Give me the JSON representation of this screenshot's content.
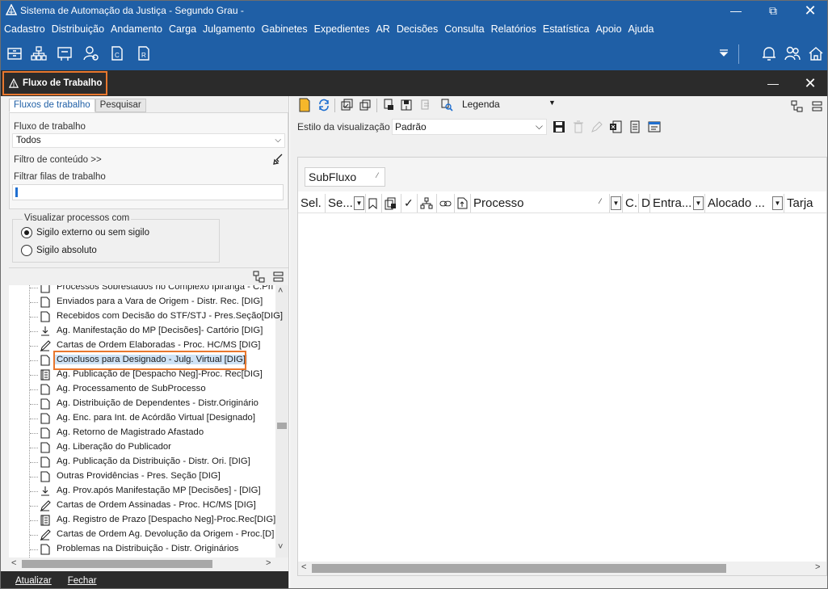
{
  "window": {
    "title": "Sistema de Automação da Justiça - Segundo Grau -",
    "controls": [
      "minimize",
      "restore",
      "close"
    ]
  },
  "menu": [
    "Cadastro",
    "Distribuição",
    "Andamento",
    "Carga",
    "Julgamento",
    "Gabinetes",
    "Expedientes",
    "AR",
    "Decisões",
    "Consulta",
    "Relatórios",
    "Estatística",
    "Apoio",
    "Ajuda"
  ],
  "panel": {
    "title": "Fluxo de Trabalho"
  },
  "left": {
    "tabs": [
      "Fluxos de trabalho",
      "Pesquisar"
    ],
    "fluxo_label": "Fluxo de trabalho",
    "fluxo_value": "Todos",
    "filtro_conteudo": "Filtro de conteúdo >>",
    "filtrar_filas_label": "Filtrar filas de trabalho",
    "filtrar_filas_value": "",
    "visualizar_legend": "Visualizar processos com",
    "radio_externo": "Sigilo externo ou sem sigilo",
    "radio_absoluto": "Sigilo absoluto",
    "tree": [
      {
        "label": "Processos Sobrestados no Complexo Ipiranga - C.Pri",
        "icon": "doc-icon"
      },
      {
        "label": "Enviados para a Vara de Origem - Distr. Rec. [DIG]",
        "icon": "doc-icon"
      },
      {
        "label": "Recebidos com Decisão do STF/STJ - Pres.Seção[DIG]",
        "icon": "doc-icon"
      },
      {
        "label": "Ag. Manifestação do MP [Decisões]- Cartório [DIG]",
        "icon": "download-icon"
      },
      {
        "label": "Cartas de Ordem Elaboradas - Proc. HC/MS [DIG]",
        "icon": "pen-icon"
      },
      {
        "label": "Conclusos para Designado - Julg. Virtual [DIG]",
        "icon": "doc-icon"
      },
      {
        "label": "Ag. Publicação de [Despacho Neg]-Proc. Rec[DIG]",
        "icon": "book-icon"
      },
      {
        "label": "Ag. Processamento de SubProcesso",
        "icon": "doc-icon"
      },
      {
        "label": "Ag. Distribuição de Dependentes - Distr.Originário",
        "icon": "doc-icon"
      },
      {
        "label": "Ag. Enc. para Int. de Acórdão Virtual [Designado]",
        "icon": "doc-icon"
      },
      {
        "label": "Ag. Retorno de Magistrado Afastado",
        "icon": "doc-icon"
      },
      {
        "label": "Ag. Liberação do Publicador",
        "icon": "doc-icon"
      },
      {
        "label": "Ag. Publicação da Distribuição - Distr. Ori. [DIG]",
        "icon": "doc-icon"
      },
      {
        "label": "Outras Providências - Pres. Seção [DIG]",
        "icon": "doc-icon"
      },
      {
        "label": "Ag. Prov.após Manifestação MP [Decisões] - [DIG]",
        "icon": "download-icon"
      },
      {
        "label": "Cartas de Ordem Assinadas - Proc. HC/MS [DIG]",
        "icon": "pen-icon"
      },
      {
        "label": "Ag. Registro de Prazo [Despacho Neg]-Proc.Rec[DIG]",
        "icon": "book-icon"
      },
      {
        "label": "Cartas de Ordem Ag. Devolução da Origem - Proc.[D]",
        "icon": "pen-icon"
      },
      {
        "label": "Problemas na Distribuição - Distr. Originários",
        "icon": "doc-icon"
      }
    ],
    "selected_index": 5,
    "atualizar": "Atualizar",
    "fechar": "Fechar"
  },
  "right": {
    "legenda": "Legenda",
    "estilo_label": "Estilo da visualização",
    "estilo_value": "Padrão",
    "group_chip": "SubFluxo",
    "columns": [
      "Sel.",
      "Se...",
      "",
      "",
      "",
      "",
      "",
      "",
      "Processo",
      "C.",
      "D",
      "Entra...",
      "Alocado ...",
      "Tarja"
    ]
  }
}
